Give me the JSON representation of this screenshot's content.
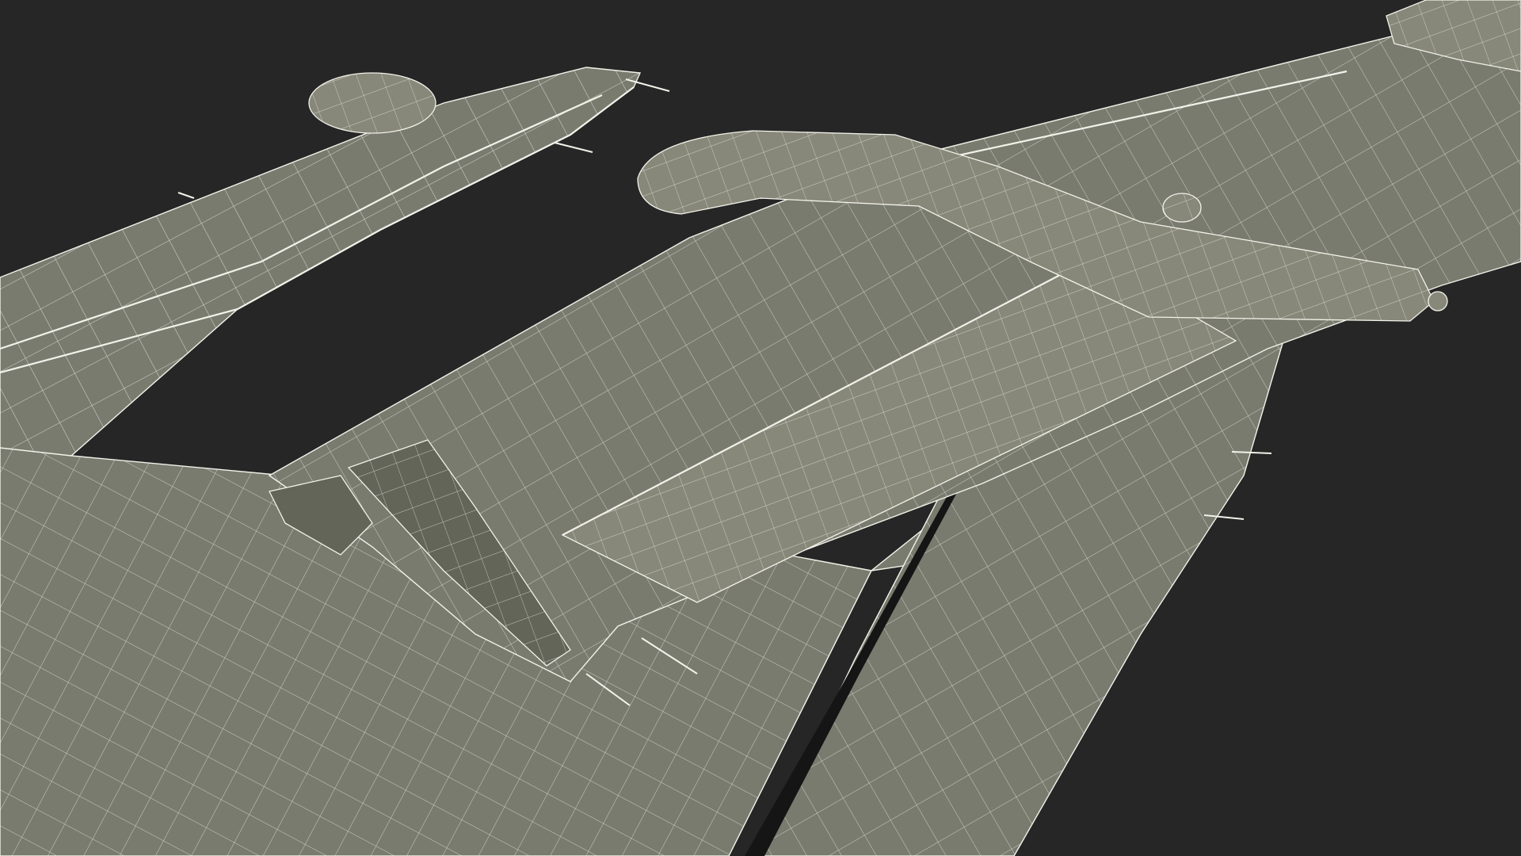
{
  "scene": {
    "subject": "aircraft-wing-wireframe",
    "colors": {
      "background": "#262626",
      "surface": "#7a7b6f",
      "surface_light": "#878879",
      "surface_dark": "#646559",
      "shadow": "#151515",
      "wire": "#f2f2ea"
    }
  }
}
